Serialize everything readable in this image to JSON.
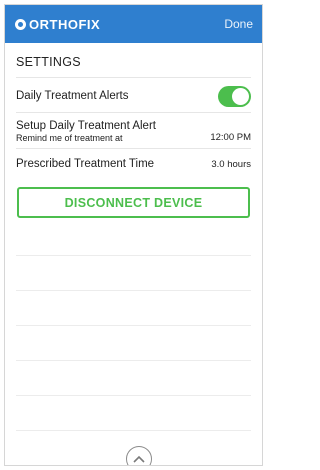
{
  "header": {
    "logo_text": "ORTHOFIX",
    "done_label": "Done"
  },
  "settings": {
    "title": "SETTINGS",
    "daily_alerts": {
      "label": "Daily Treatment Alerts",
      "enabled": true
    },
    "setup_alert": {
      "title": "Setup Daily Treatment Alert",
      "subtitle": "Remind me of treatment at",
      "time": "12:00 PM"
    },
    "prescribed": {
      "label": "Prescribed Treatment Time",
      "value": "3.0 hours"
    },
    "disconnect_label": "DISCONNECT DEVICE"
  },
  "footer": {
    "scroll_up_icon": "chevron-up-icon"
  },
  "colors": {
    "header_blue": "#2f7fcf",
    "accent_green": "#4cbe4d"
  }
}
